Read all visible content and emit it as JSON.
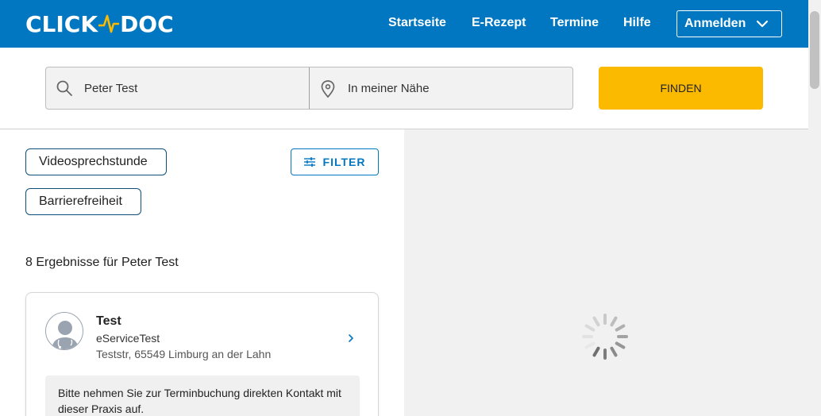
{
  "header": {
    "logo_left": "CLICK",
    "logo_right": "DOC",
    "nav": [
      {
        "label": "Startseite"
      },
      {
        "label": "E-Rezept"
      },
      {
        "label": "Termine"
      },
      {
        "label": "Hilfe"
      }
    ],
    "login_label": "Anmelden"
  },
  "search": {
    "name_value": "Peter Test",
    "location_placeholder": "In meiner Nähe",
    "find_label": "FINDEN"
  },
  "filters": {
    "chips": [
      {
        "label": "Videosprechstunde"
      },
      {
        "label": "Barrierefreiheit"
      }
    ],
    "filter_label": "FILTER"
  },
  "results": {
    "count_text": "8 Ergebnisse für Peter Test",
    "items": [
      {
        "title": "Test",
        "subtitle": "eServiceTest",
        "address": "Teststr, 65549 Limburg an der Lahn",
        "note": "Bitte nehmen Sie zur Terminbuchung direkten Kontakt mit dieser Praxis auf."
      }
    ]
  },
  "colors": {
    "brand_blue": "#0077c0",
    "find_yellow": "#fbba00",
    "logo_accent": "#fbba00"
  },
  "icons": {
    "search": "search-icon",
    "location": "location-pin-icon",
    "filter": "sliders-icon",
    "chevron_right": "chevron-right-icon",
    "chevron_down": "chevron-down-icon",
    "loading": "loading-spinner-icon"
  }
}
